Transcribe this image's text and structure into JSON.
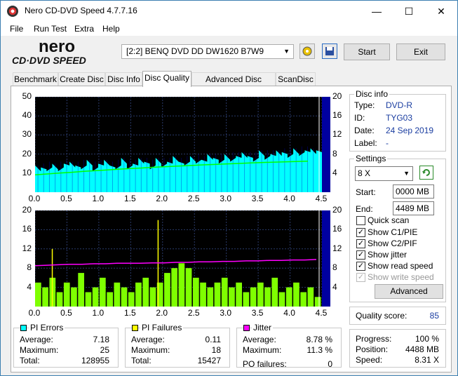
{
  "window": {
    "title": "Nero CD-DVD Speed 4.7.7.16",
    "minimize": "—",
    "maximize": "☐",
    "close": "✕"
  },
  "menu": [
    "File",
    "Run Test",
    "Extra",
    "Help"
  ],
  "logo": {
    "top": "nero",
    "bottom": "CD·DVD SPEED"
  },
  "toolbar": {
    "drive": "[2:2]   BENQ DVD DD DW1620 B7W9",
    "start": "Start",
    "exit": "Exit"
  },
  "tabs": [
    "Benchmark",
    "Create Disc",
    "Disc Info",
    "Disc Quality",
    "Advanced Disc Quality",
    "ScanDisc"
  ],
  "active_tab": "Disc Quality",
  "disc_info": {
    "title": "Disc info",
    "type_label": "Type:",
    "type": "DVD-R",
    "id_label": "ID:",
    "id": "TYG03",
    "date_label": "Date:",
    "date": "24 Sep 2019",
    "label_label": "Label:",
    "label": "-"
  },
  "settings": {
    "title": "Settings",
    "speed": "8 X",
    "start_label": "Start:",
    "start": "0000 MB",
    "end_label": "End:",
    "end": "4489 MB",
    "quick_scan": "Quick scan",
    "show_c1pie": "Show C1/PIE",
    "show_c2pif": "Show C2/PIF",
    "show_jitter": "Show jitter",
    "show_read_speed": "Show read speed",
    "show_write_speed": "Show write speed",
    "advanced": "Advanced",
    "checks": {
      "quick_scan": false,
      "show_c1pie": true,
      "show_c2pif": true,
      "show_jitter": true,
      "show_read_speed": true,
      "show_write_speed": true
    }
  },
  "quality": {
    "label": "Quality score:",
    "value": "85"
  },
  "progress": {
    "progress_label": "Progress:",
    "progress": "100 %",
    "position_label": "Position:",
    "position": "4488 MB",
    "speed_label": "Speed:",
    "speed": "8.31 X"
  },
  "pi_errors": {
    "title": "PI Errors",
    "color": "#00ffff",
    "avg_label": "Average:",
    "avg": "7.18",
    "max_label": "Maximum:",
    "max": "25",
    "total_label": "Total:",
    "total": "128955"
  },
  "pi_failures": {
    "title": "PI Failures",
    "color": "#ffff00",
    "avg_label": "Average:",
    "avg": "0.11",
    "max_label": "Maximum:",
    "max": "18",
    "total_label": "Total:",
    "total": "15427"
  },
  "jitter": {
    "title": "Jitter",
    "color": "#ff00ff",
    "avg_label": "Average:",
    "avg": "8.78 %",
    "max_label": "Maximum:",
    "max": "11.3 %",
    "po_label": "PO failures:",
    "po": "0"
  },
  "chart_data": [
    {
      "type": "area",
      "series": [
        {
          "name": "PI Errors",
          "color": "#00ffff",
          "values": [
            11,
            12,
            13,
            12,
            13,
            14,
            13,
            13,
            14,
            14,
            13,
            14,
            14,
            13,
            14,
            15,
            14,
            14,
            15,
            15,
            14,
            15,
            15,
            15,
            16,
            15,
            16,
            16,
            17,
            16,
            17,
            17,
            17,
            17,
            18,
            18,
            18,
            18,
            18,
            19,
            19,
            19,
            19,
            20,
            20,
            20,
            21,
            21,
            20,
            21
          ]
        },
        {
          "name": "Read speed",
          "color": "#00ff00",
          "values": [
            12.0,
            12.6,
            13.2,
            13.7,
            14.3,
            14.8,
            15.3,
            15.8,
            16.3,
            16.7,
            17.2,
            17.6,
            18.0,
            18.4,
            18.8,
            19.1,
            19.5,
            19.8,
            20.1,
            20.4,
            20.7,
            20.9,
            21.2,
            21.4
          ]
        }
      ],
      "x": [
        0.0,
        0.5,
        1.0,
        1.5,
        2.0,
        2.5,
        3.0,
        3.5,
        4.0,
        4.5
      ],
      "xlim": [
        0,
        4.5
      ],
      "ylim_left": [
        0,
        50
      ],
      "yticks_left": [
        10,
        20,
        30,
        40,
        50
      ],
      "ylim_right": [
        0,
        20
      ],
      "yticks_right": [
        4,
        8,
        12,
        16,
        20
      ]
    },
    {
      "type": "bar",
      "series": [
        {
          "name": "PI Failures",
          "color": "#7fff00",
          "values": [
            5,
            4,
            6,
            3,
            5,
            4,
            7,
            3,
            4,
            6,
            3,
            5,
            4,
            3,
            5,
            6,
            4,
            5,
            7,
            8,
            9,
            8,
            6,
            5,
            4,
            5,
            6,
            4,
            5,
            3,
            4,
            5,
            4,
            6,
            3,
            4,
            5,
            3,
            4,
            2
          ]
        },
        {
          "name": "Jitter",
          "color": "#ff00ff",
          "values": [
            8.5,
            8.6,
            8.7,
            8.8,
            8.8,
            8.9,
            8.9,
            9.0,
            9.0,
            9.0,
            9.1,
            9.1,
            9.2,
            9.2,
            9.3,
            9.3,
            9.4,
            9.4,
            9.5,
            9.5,
            9.6,
            9.6,
            9.7,
            9.7,
            9.8
          ]
        }
      ],
      "peaks": [
        {
          "x": 0.27,
          "y": 12
        },
        {
          "x": 1.93,
          "y": 18
        }
      ],
      "x": [
        0.0,
        0.5,
        1.0,
        1.5,
        2.0,
        2.5,
        3.0,
        3.5,
        4.0,
        4.5
      ],
      "xlim": [
        0,
        4.5
      ],
      "ylim_left": [
        0,
        20
      ],
      "yticks_left": [
        4,
        8,
        12,
        16,
        20
      ],
      "ylim_right": [
        0,
        20
      ],
      "yticks_right": [
        4,
        8,
        12,
        16,
        20
      ]
    }
  ]
}
